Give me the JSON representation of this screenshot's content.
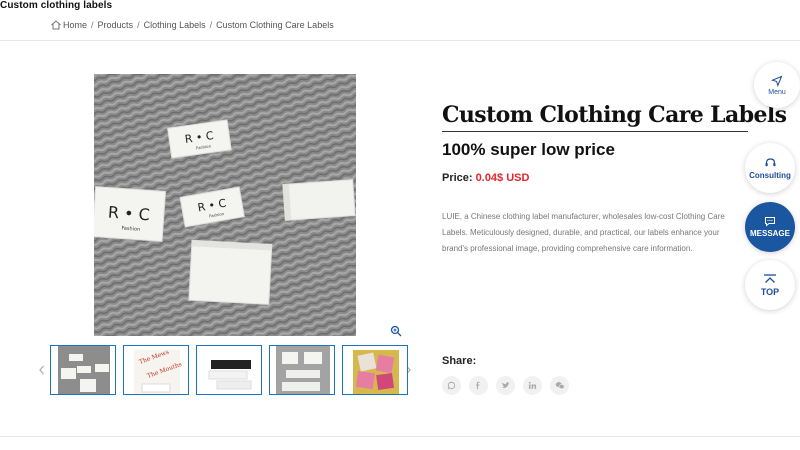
{
  "page": {
    "top_title": "Custom clothing labels"
  },
  "breadcrumb": {
    "items": [
      "Home",
      "Products",
      "Clothing Labels",
      "Custom Clothing Care Labels"
    ]
  },
  "product": {
    "title": "Custom Clothing Care Labels",
    "subhead": "100% super low price",
    "price_label": "Price:",
    "price_value": "0.04$ USD",
    "description": "LUIE, a Chinese clothing label manufacturer, wholesales low-cost Clothing Care Labels. Meticulously designed, durable, and practical, our labels enhance your brand's professional image, providing comprehensive care information."
  },
  "gallery": {
    "main_label_text": "R • C",
    "main_label_subtext": "Fashion",
    "thumb_labels": [
      "The Mews",
      "The Mouths"
    ]
  },
  "share": {
    "label": "Share:",
    "icons": [
      "whatsapp-icon",
      "facebook-icon",
      "twitter-icon",
      "linkedin-icon",
      "wechat-icon"
    ]
  },
  "floating": {
    "menu": "Menu",
    "consulting": "Consulting",
    "message": "MESSAGE",
    "top": "TOP"
  },
  "colors": {
    "accent": "#1b56a0",
    "price": "#e4252b",
    "thumb_border": "#1b73c2"
  }
}
